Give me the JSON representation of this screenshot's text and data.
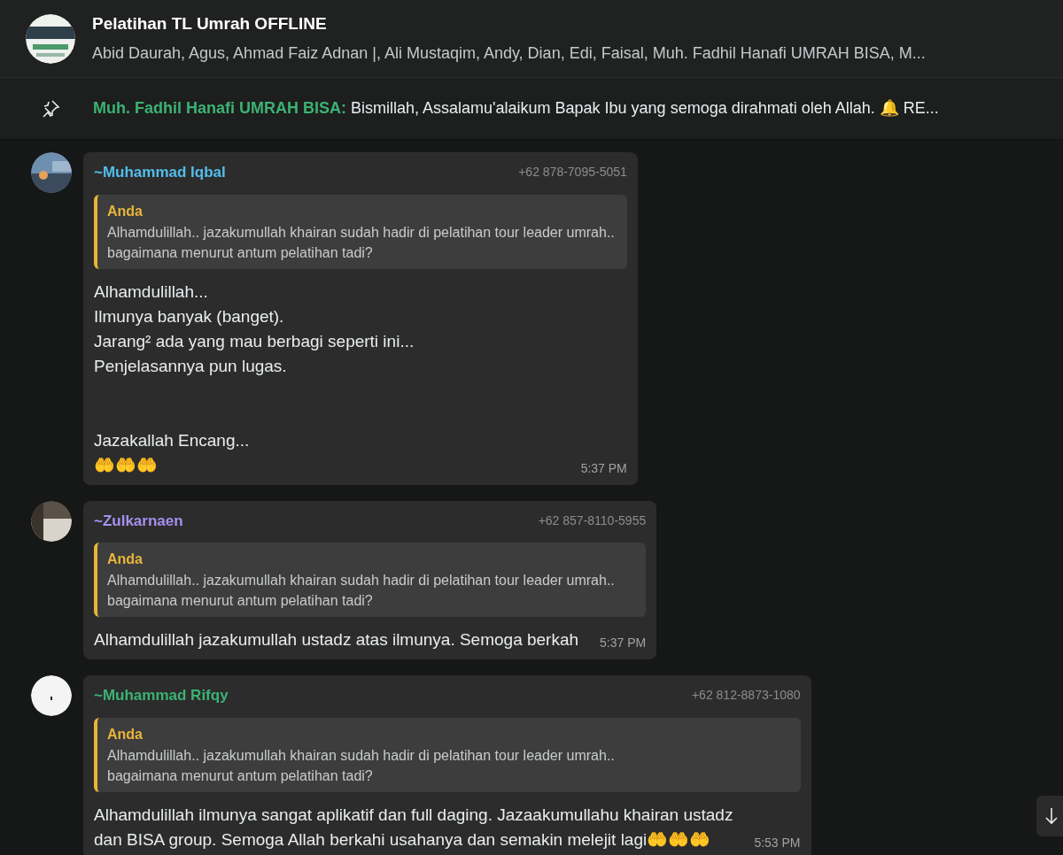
{
  "header": {
    "title": "Pelatihan TL Umrah OFFLINE",
    "members": "Abid Daurah, Agus, Ahmad Faiz Adnan |, Ali Mustaqim, Andy, Dian, Edi, Faisal, Muh. Fadhil Hanafi UMRAH BISA, M..."
  },
  "pinned": {
    "sender": "Muh. Fadhil Hanafi UMRAH BISA:",
    "text": "Bismillah, Assalamu'alaikum Bapak Ibu yang semoga dirahmati oleh Allah. 🔔 RE..."
  },
  "messages": [
    {
      "sender": "~Muhammad Iqbal",
      "color": "#53bdeb",
      "phone": "+62 878-7095-5051",
      "quote": {
        "author": "Anda",
        "lines": [
          "Alhamdulillah.. jazakumullah khairan sudah hadir di pelatihan tour leader umrah..",
          "bagaimana menurut antum pelatihan tadi?"
        ]
      },
      "paragraphs": [
        [
          "Alhamdulillah...",
          "Ilmunya banyak (banget).",
          "Jarang² ada yang mau berbagi seperti ini...",
          "Penjelasannya pun lugas."
        ],
        [
          "Jazakallah Encang...",
          "🤲🤲🤲"
        ]
      ],
      "time": "5:37 PM"
    },
    {
      "sender": "~Zulkarnaen",
      "color": "#a590f0",
      "phone": "+62 857-8110-5955",
      "quote": {
        "author": "Anda",
        "lines": [
          "Alhamdulillah.. jazakumullah khairan sudah hadir di pelatihan tour leader umrah..",
          "bagaimana menurut antum pelatihan tadi?"
        ]
      },
      "paragraphs": [
        [
          "Alhamdulillah jazakumullah ustadz atas ilmunya. Semoga berkah"
        ]
      ],
      "time": "5:37 PM"
    },
    {
      "sender": "~Muhammad Rifqy",
      "color": "#3bb273",
      "phone": "+62 812-8873-1080",
      "quote": {
        "author": "Anda",
        "lines": [
          "Alhamdulillah.. jazakumullah khairan sudah hadir di pelatihan tour leader umrah..",
          "bagaimana menurut antum pelatihan tadi?"
        ]
      },
      "paragraphs": [
        [
          "Alhamdulillah ilmunya sangat aplikatif dan full daging. Jazaakumullahu khairan ustadz",
          "dan BISA group. Semoga Allah berkahi usahanya dan semakin melejit lagi🤲🤲🤲"
        ]
      ],
      "time": "5:53 PM"
    }
  ]
}
